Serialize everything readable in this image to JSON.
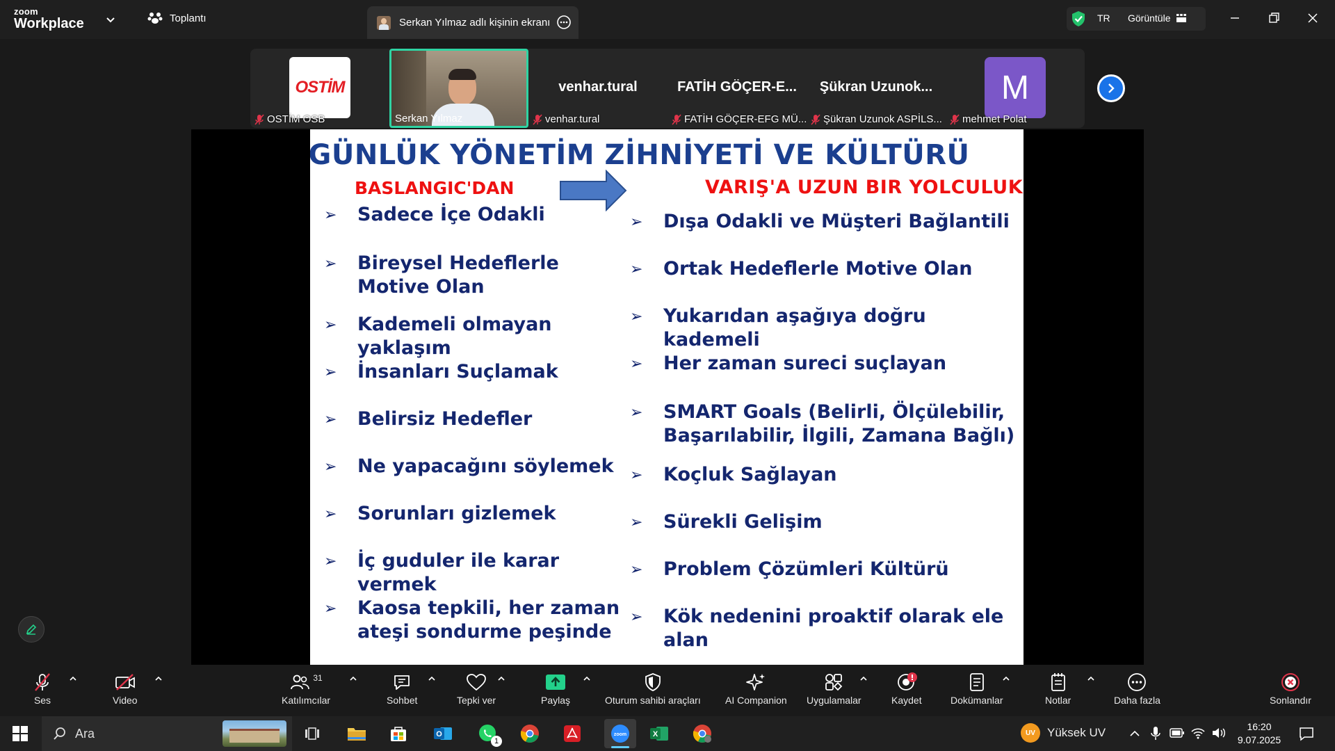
{
  "app": {
    "logo_line1": "zoom",
    "logo_line2": "Workplace"
  },
  "topbar": {
    "meeting_label": "Toplantı",
    "share_tab_label": "Serkan Yılmaz adlı kişinin ekranı",
    "language": "TR",
    "view_label": "Görüntüle"
  },
  "participants": [
    {
      "name": "OSTİM OSB",
      "logo_text": "OSTİM"
    },
    {
      "name": "Serkan Yılmaz"
    },
    {
      "name": "venhar.tural",
      "display": "venhar.tural"
    },
    {
      "name": "FATİH GÖÇER-EFG MÜ...",
      "display": "FATİH  GÖÇER-E..."
    },
    {
      "name": "Şükran Uzunok ASPİLS...",
      "display": "Şükran Uzunok..."
    },
    {
      "name": "mehmet Polat",
      "initial": "M"
    }
  ],
  "slide": {
    "title": "GÜNLÜK YÖNETİM ZİHNİYETİ VE KÜLTÜRÜ",
    "left_heading": "BASLANGIC'DAN",
    "right_heading": "VARIŞ'A UZUN BIR YOLCULUK",
    "bullet": "➢",
    "left_items": [
      "Sadece İçe Odakli",
      "Bireysel Hedeflerle Motive Olan",
      "Kademeli olmayan yaklaşım",
      "İnsanları Suçlamak",
      "Belirsiz Hedefler",
      "Ne yapacağını söylemek",
      "Sorunları gizlemek",
      "İç guduler ile karar vermek",
      "Kaosa tepkili, her zaman ateşi sondurme peşinde"
    ],
    "right_items": [
      "Dışa Odakli ve Müşteri Bağlantili",
      "Ortak Hedeflerle Motive Olan",
      "Yukarıdan aşağıya doğru kademeli",
      "Her zaman sureci suçlayan",
      "SMART Goals (Belirli, Ölçülebilir, Başarılabilir, İlgili, Zamana Bağlı)",
      "Koçluk Sağlayan",
      "Sürekli Gelişim",
      "Problem Çözümleri Kültürü",
      "Kök nedenini proaktif olarak ele alan"
    ]
  },
  "toolbar": {
    "audio": "Ses",
    "video": "Video",
    "participants": "Katılımcılar",
    "participants_count": "31",
    "chat": "Sohbet",
    "reactions": "Tepki ver",
    "share": "Paylaş",
    "host_tools": "Oturum sahibi araçları",
    "ai_companion": "AI Companion",
    "apps": "Uygulamalar",
    "record": "Kaydet",
    "docs": "Dokümanlar",
    "notes": "Notlar",
    "more": "Daha fazla",
    "end": "Sonlandır"
  },
  "taskbar": {
    "search_placeholder": "Ara",
    "whatsapp_badge": "1",
    "weather_label": "Yüksek UV",
    "weather_badge": "UV",
    "time": "16:20",
    "date": "9.07.2025"
  },
  "colors": {
    "accent_blue": "#1a73e8",
    "share_green": "#23d18b",
    "slide_title": "#1b3f8f",
    "slide_red": "#ee1111",
    "mute_red": "#e0344a"
  }
}
